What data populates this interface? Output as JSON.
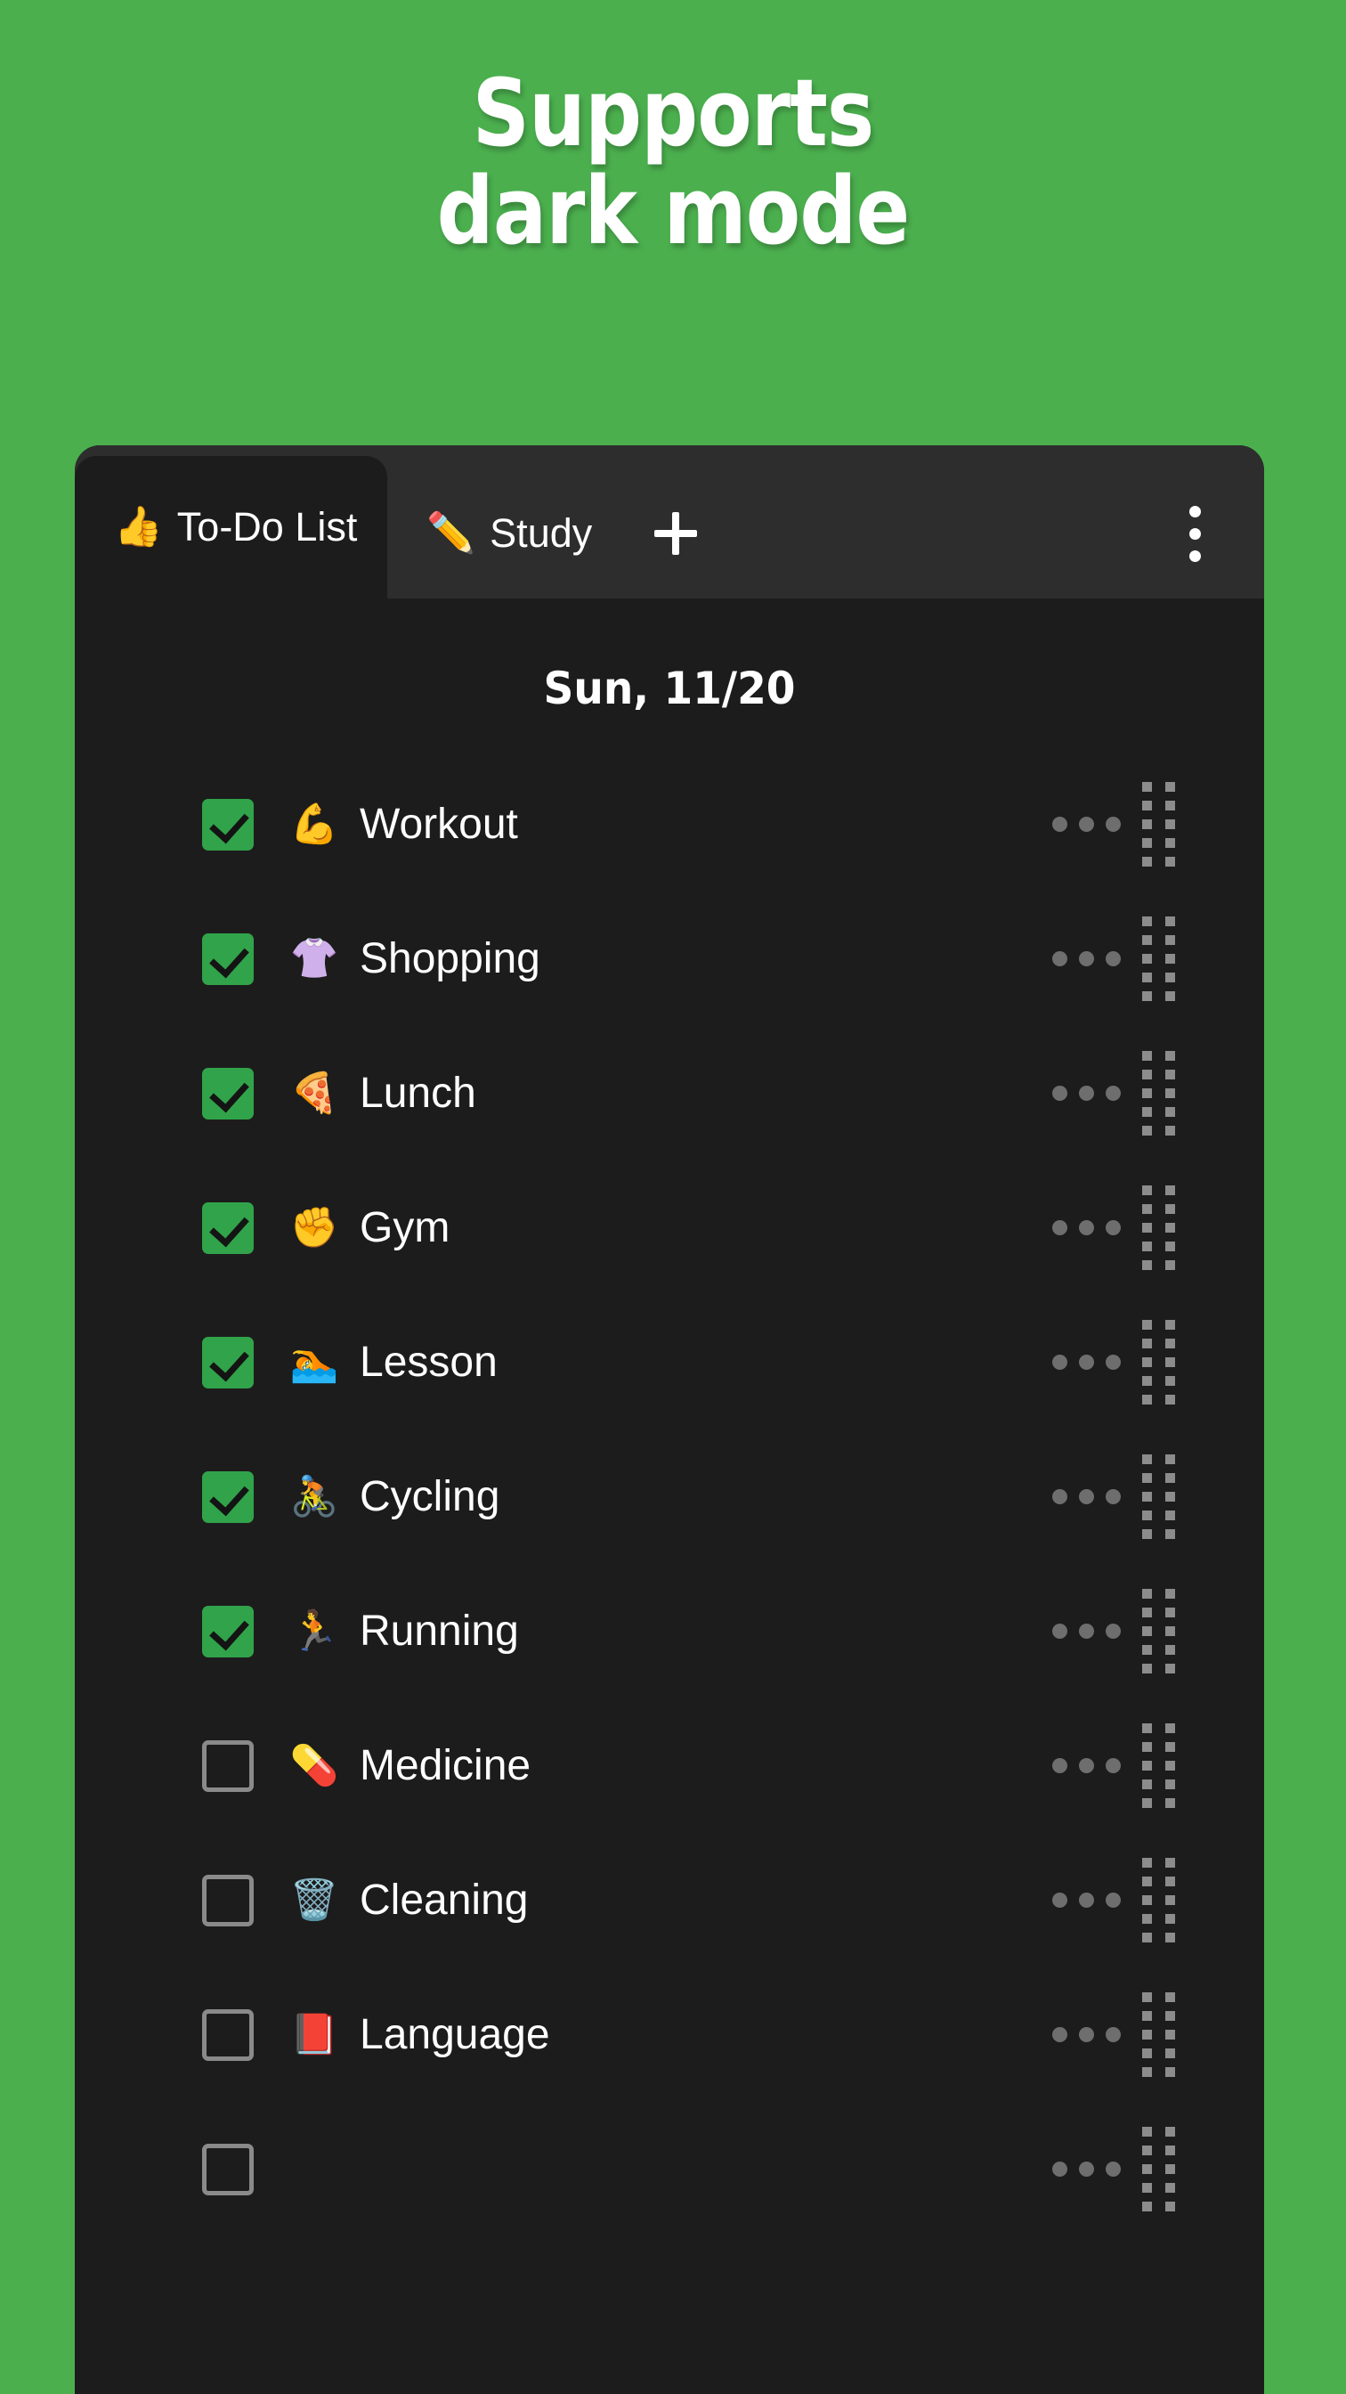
{
  "promo": {
    "background_color": "#4BAF4E",
    "headline_lines": [
      "Supports",
      "dark mode"
    ]
  },
  "app": {
    "surface_color": "#1c1c1c",
    "tabbar_color": "#2d2d2d",
    "accent_color": "#31A34A",
    "tabs": [
      {
        "emoji": "👍",
        "label": "To-Do List",
        "active": true
      },
      {
        "emoji": "✏️",
        "label": "Study",
        "active": false
      }
    ],
    "add_tab_label": "+",
    "overflow_menu_label": "⋮",
    "date_header": "Sun, 11/20",
    "tasks": [
      {
        "checked": true,
        "emoji": "💪",
        "label": "Workout"
      },
      {
        "checked": true,
        "emoji": "👚",
        "label": "Shopping"
      },
      {
        "checked": true,
        "emoji": "🍕",
        "label": "Lunch"
      },
      {
        "checked": true,
        "emoji": "✊",
        "label": "Gym"
      },
      {
        "checked": true,
        "emoji": "🏊",
        "label": "Lesson"
      },
      {
        "checked": true,
        "emoji": "🚴",
        "label": "Cycling"
      },
      {
        "checked": true,
        "emoji": "🏃",
        "label": "Running"
      },
      {
        "checked": false,
        "emoji": "💊",
        "label": "Medicine"
      },
      {
        "checked": false,
        "emoji": "🗑️",
        "label": "Cleaning"
      },
      {
        "checked": false,
        "emoji": "📕",
        "label": "Language"
      },
      {
        "checked": false,
        "emoji": "",
        "label": ""
      }
    ]
  }
}
